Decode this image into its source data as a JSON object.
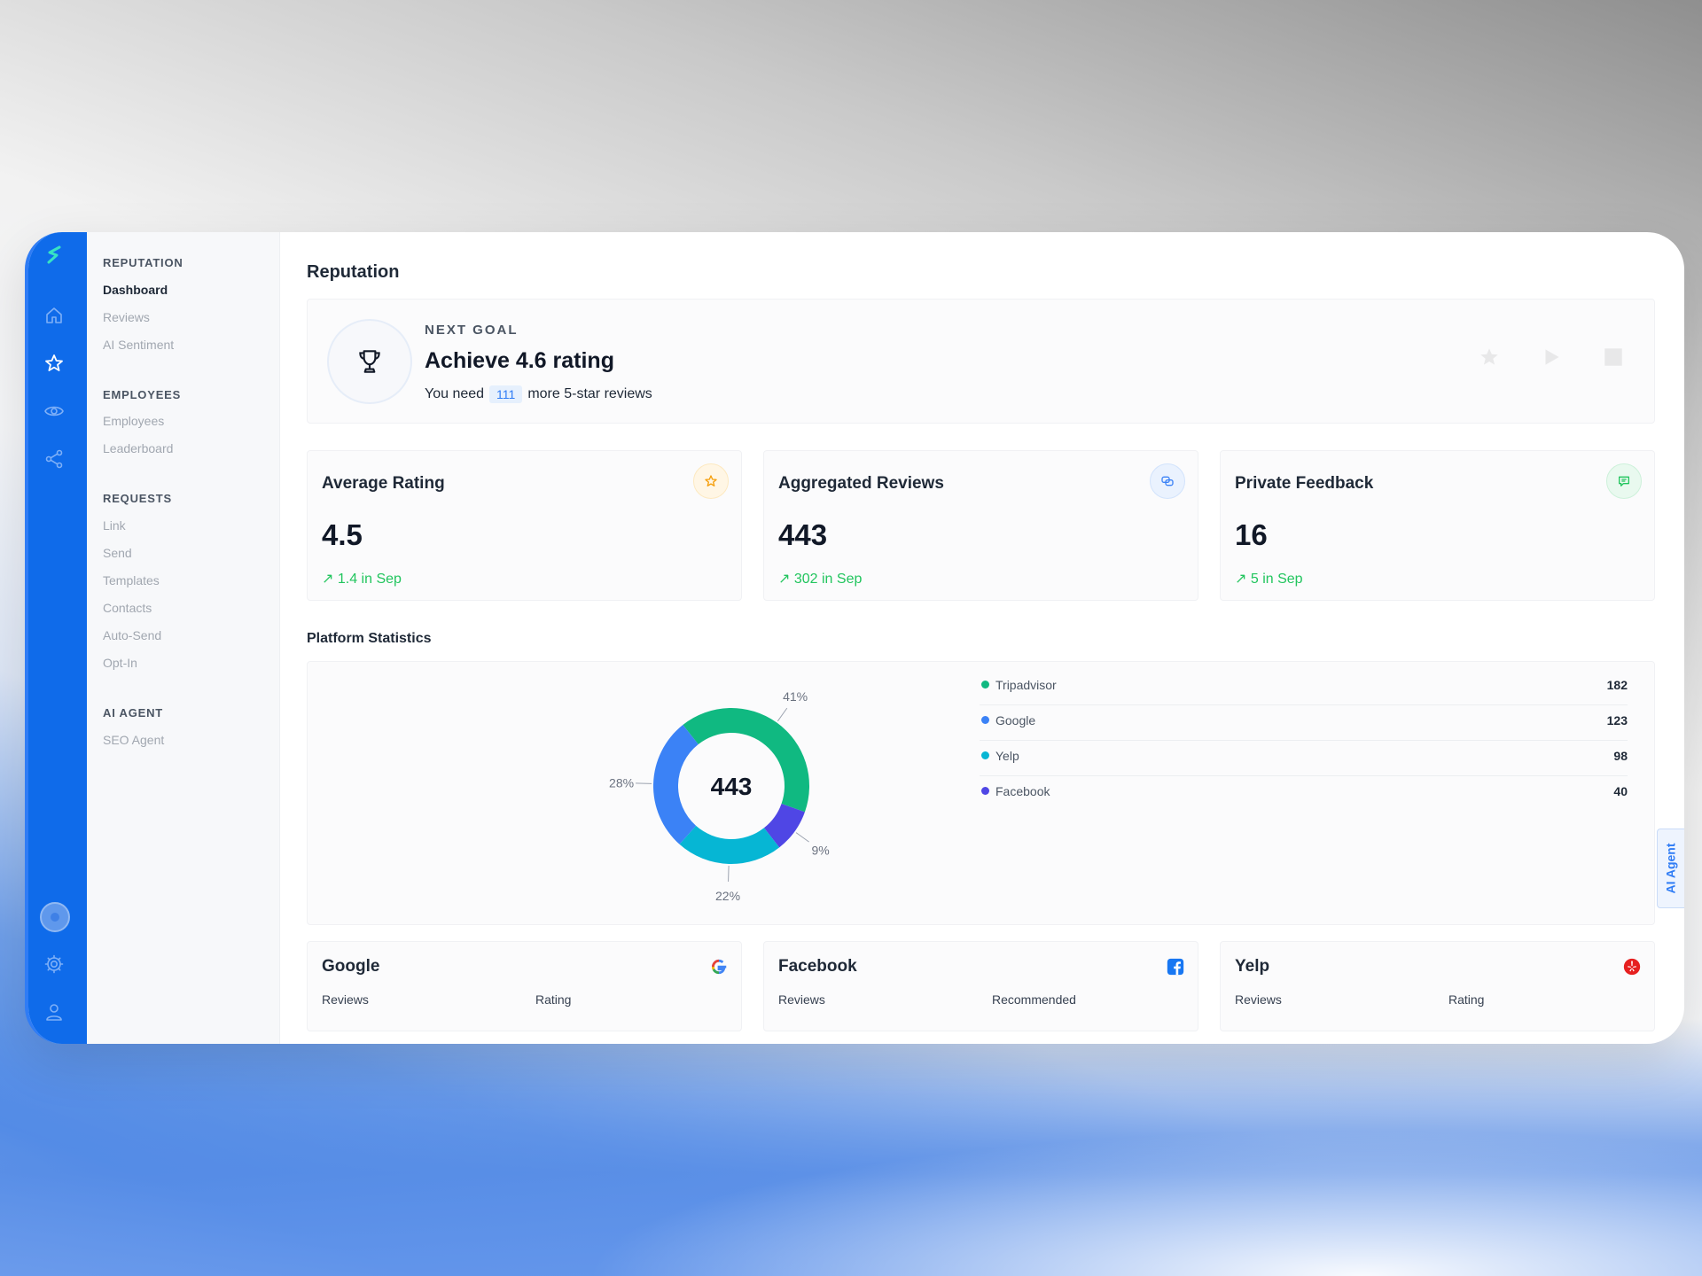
{
  "nav": {
    "sections": [
      {
        "title": "REPUTATION",
        "items": [
          "Dashboard",
          "Reviews",
          "AI Sentiment"
        ]
      },
      {
        "title": "EMPLOYEES",
        "items": [
          "Employees",
          "Leaderboard"
        ]
      },
      {
        "title": "REQUESTS",
        "items": [
          "Link",
          "Send",
          "Templates",
          "Contacts",
          "Auto-Send",
          "Opt-In"
        ]
      },
      {
        "title": "AI AGENT",
        "items": [
          "SEO Agent"
        ]
      }
    ],
    "active": "Dashboard"
  },
  "page": {
    "title": "Reputation"
  },
  "goal": {
    "label": "NEXT GOAL",
    "headline": "Achieve 4.6 rating",
    "sub_before": "You need",
    "count": "111",
    "sub_after": "more 5-star reviews"
  },
  "cards": [
    {
      "title": "Average Rating",
      "value": "4.5",
      "delta": "↗ 1.4 in Sep",
      "icon": "star-icon",
      "accent": "#f59e0b"
    },
    {
      "title": "Aggregated Reviews",
      "value": "443",
      "delta": "↗ 302 in Sep",
      "icon": "chat-bubbles-icon",
      "accent": "#3b82f6"
    },
    {
      "title": "Private Feedback",
      "value": "16",
      "delta": "↗ 5 in Sep",
      "icon": "message-icon",
      "accent": "#22c55e"
    }
  ],
  "platform_stats": {
    "title": "Platform Statistics",
    "total": "443",
    "legend": [
      {
        "name": "Tripadvisor",
        "value": "182",
        "color": "#10b981"
      },
      {
        "name": "Google",
        "value": "123",
        "color": "#3b82f6"
      },
      {
        "name": "Yelp",
        "value": "98",
        "color": "#06b6d4"
      },
      {
        "name": "Facebook",
        "value": "40",
        "color": "#4f46e5"
      }
    ]
  },
  "chart_data": {
    "type": "pie",
    "categories": [
      "Tripadvisor",
      "Facebook",
      "Yelp",
      "Google"
    ],
    "values": [
      182,
      40,
      98,
      123
    ],
    "slice_labels": [
      "41%",
      "9%",
      "22%",
      "28%"
    ],
    "colors": [
      "#10b981",
      "#4f46e5",
      "#06b6d4",
      "#3b82f6"
    ],
    "center_label": "443",
    "title": ""
  },
  "platforms": [
    {
      "name": "Google",
      "col1": "Reviews",
      "col2": "Rating",
      "icon": "google-logo-icon"
    },
    {
      "name": "Facebook",
      "col1": "Reviews",
      "col2": "Recommended",
      "icon": "facebook-logo-icon"
    },
    {
      "name": "Yelp",
      "col1": "Reviews",
      "col2": "Rating",
      "icon": "yelp-logo-icon"
    }
  ],
  "ai_tab": "AI Agent"
}
